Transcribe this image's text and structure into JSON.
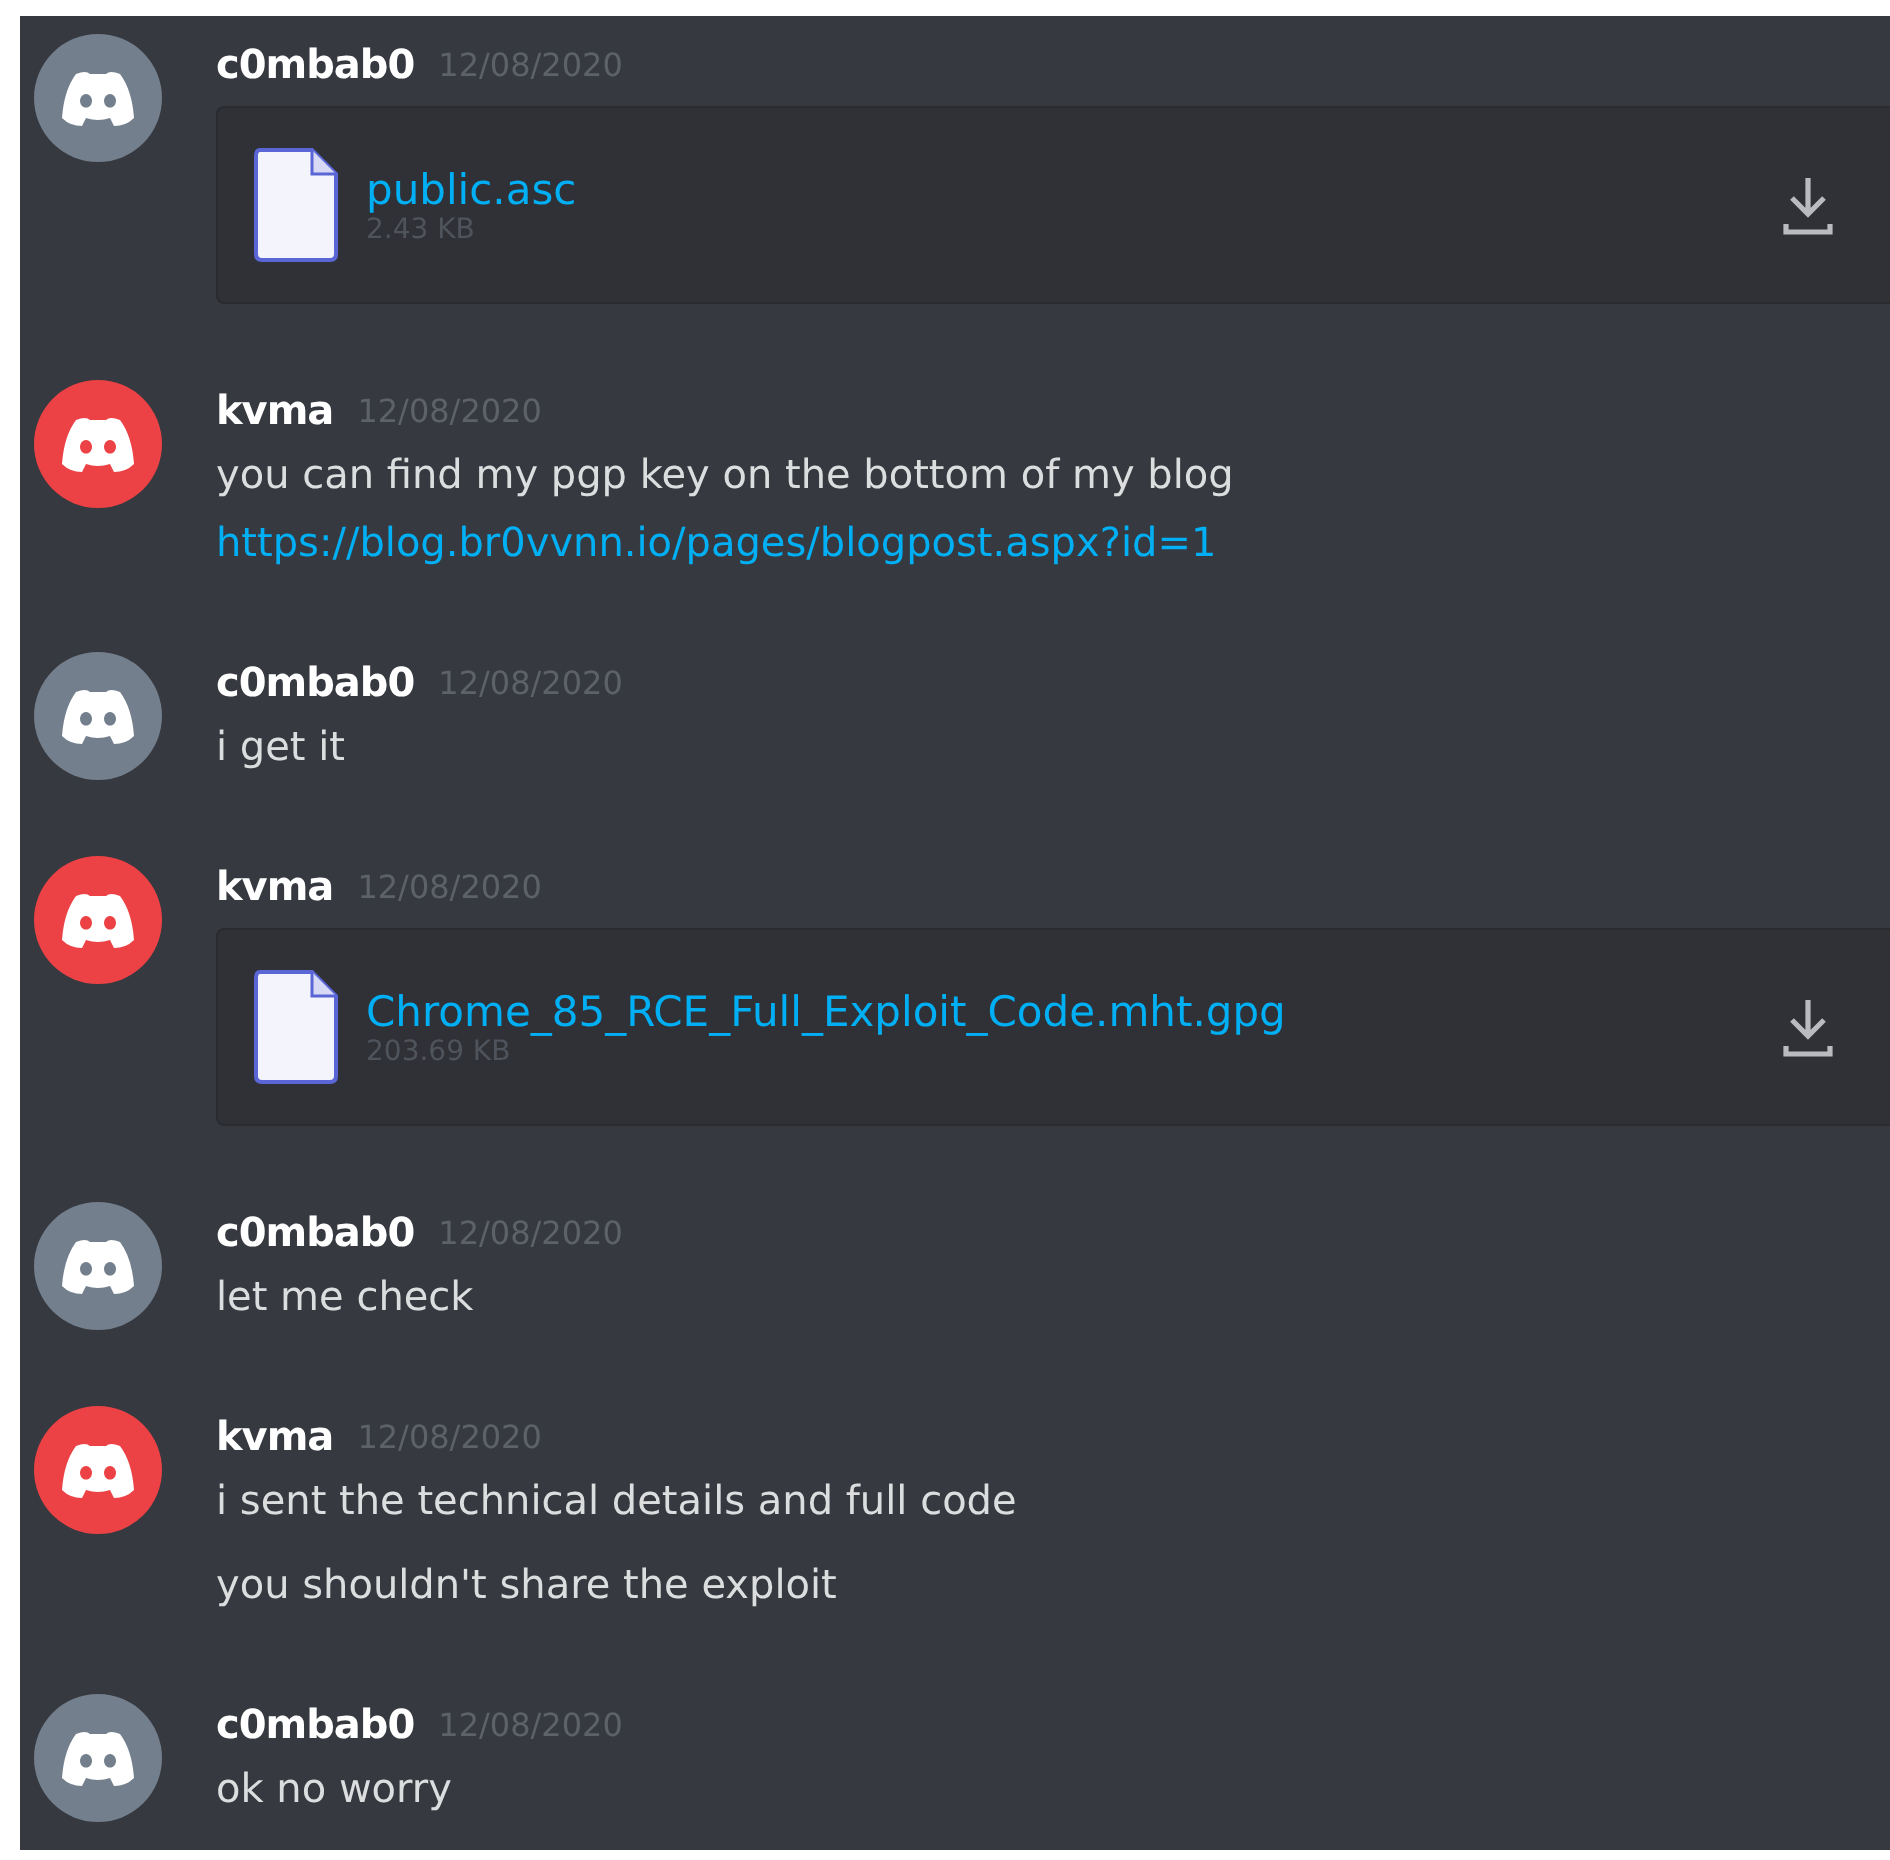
{
  "messages": [
    {
      "author": "c0mbab0",
      "timestamp": "12/08/2020",
      "color": "#747f8d",
      "items": [
        {
          "kind": "file",
          "name": "public.asc",
          "size": "2.43 KB"
        }
      ]
    },
    {
      "author": "kvma",
      "timestamp": "12/08/2020",
      "color": "#ed4245",
      "items": [
        {
          "kind": "text",
          "text": "you can find my pgp key on the bottom of my blog"
        },
        {
          "kind": "link",
          "text": "https://blog.br0vvnn.io/pages/blogpost.aspx?id=1"
        }
      ]
    },
    {
      "author": "c0mbab0",
      "timestamp": "12/08/2020",
      "color": "#747f8d",
      "items": [
        {
          "kind": "text",
          "text": "i get it"
        }
      ]
    },
    {
      "author": "kvma",
      "timestamp": "12/08/2020",
      "color": "#ed4245",
      "items": [
        {
          "kind": "file",
          "name": "Chrome_85_RCE_Full_Exploit_Code.mht.gpg",
          "size": "203.69 KB"
        }
      ]
    },
    {
      "author": "c0mbab0",
      "timestamp": "12/08/2020",
      "color": "#747f8d",
      "items": [
        {
          "kind": "text",
          "text": "let me check"
        }
      ]
    },
    {
      "author": "kvma",
      "timestamp": "12/08/2020",
      "color": "#ed4245",
      "items": [
        {
          "kind": "text",
          "text": "i sent the technical details and full code"
        },
        {
          "kind": "text",
          "text": "you shouldn't share the exploit"
        }
      ]
    },
    {
      "author": "c0mbab0",
      "timestamp": "12/08/2020",
      "color": "#747f8d",
      "items": [
        {
          "kind": "text",
          "text": "ok no worry"
        }
      ]
    }
  ]
}
